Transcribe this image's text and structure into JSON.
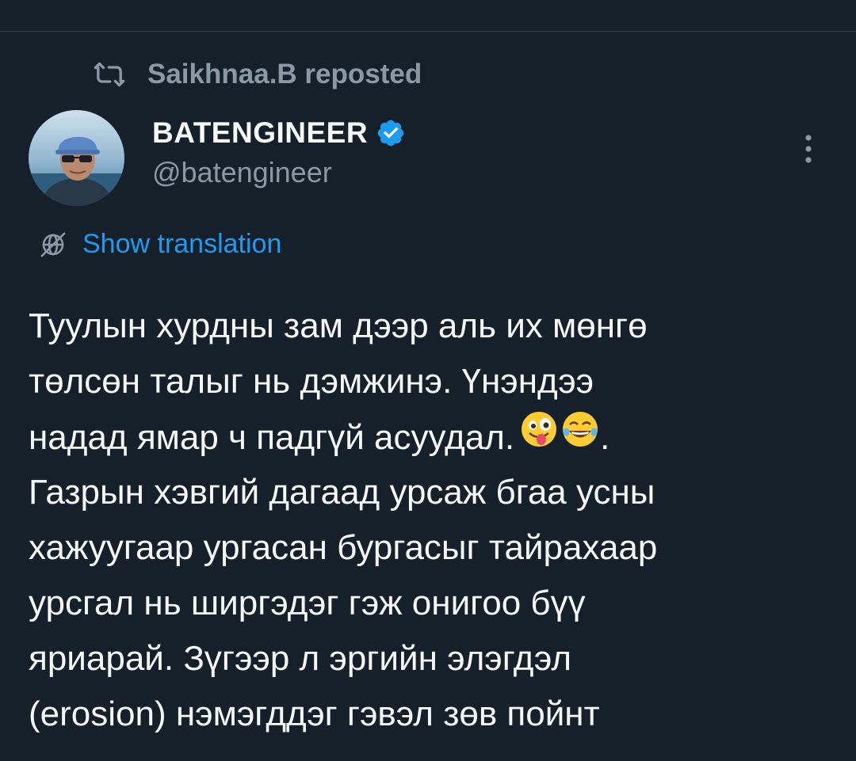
{
  "repost": {
    "icon": "repost-icon",
    "text": "Saikhnaa.B reposted"
  },
  "author": {
    "display_name": "BATENGINEER",
    "handle": "@batengineer",
    "verified": true,
    "avatar_icon": "avatar-photo",
    "verified_icon": "verified-badge-icon"
  },
  "actions": {
    "more_icon": "more-options-icon"
  },
  "translation": {
    "icon": "translate-globe-icon",
    "label": "Show translation"
  },
  "tweet": {
    "lines": [
      "Туулын хурдны зам дээр аль их мөнгө",
      "төлсөн талыг нь дэмжинэ. Үнэндээ",
      "надад ямар ч падгүй асуудал.",
      "Газрын хэвгий дагаад урсаж бгаа усны",
      "хажуугаар ургасан бургасыг тайрахаар",
      "урсгал нь ширгэдэг гэж онигоо бүү",
      "яриарай. Зүгээр л эргийн элэгдэл",
      "(erosion) нэмэгддэг гэвэл зөв пойнт"
    ],
    "line3_suffix": ".",
    "emojis": [
      "winking-tongue-emoji",
      "tears-of-joy-emoji"
    ]
  },
  "colors": {
    "background": "#15202b",
    "text": "#f7f9f9",
    "secondary": "#8b98a5",
    "accent": "#1d9bf0"
  }
}
